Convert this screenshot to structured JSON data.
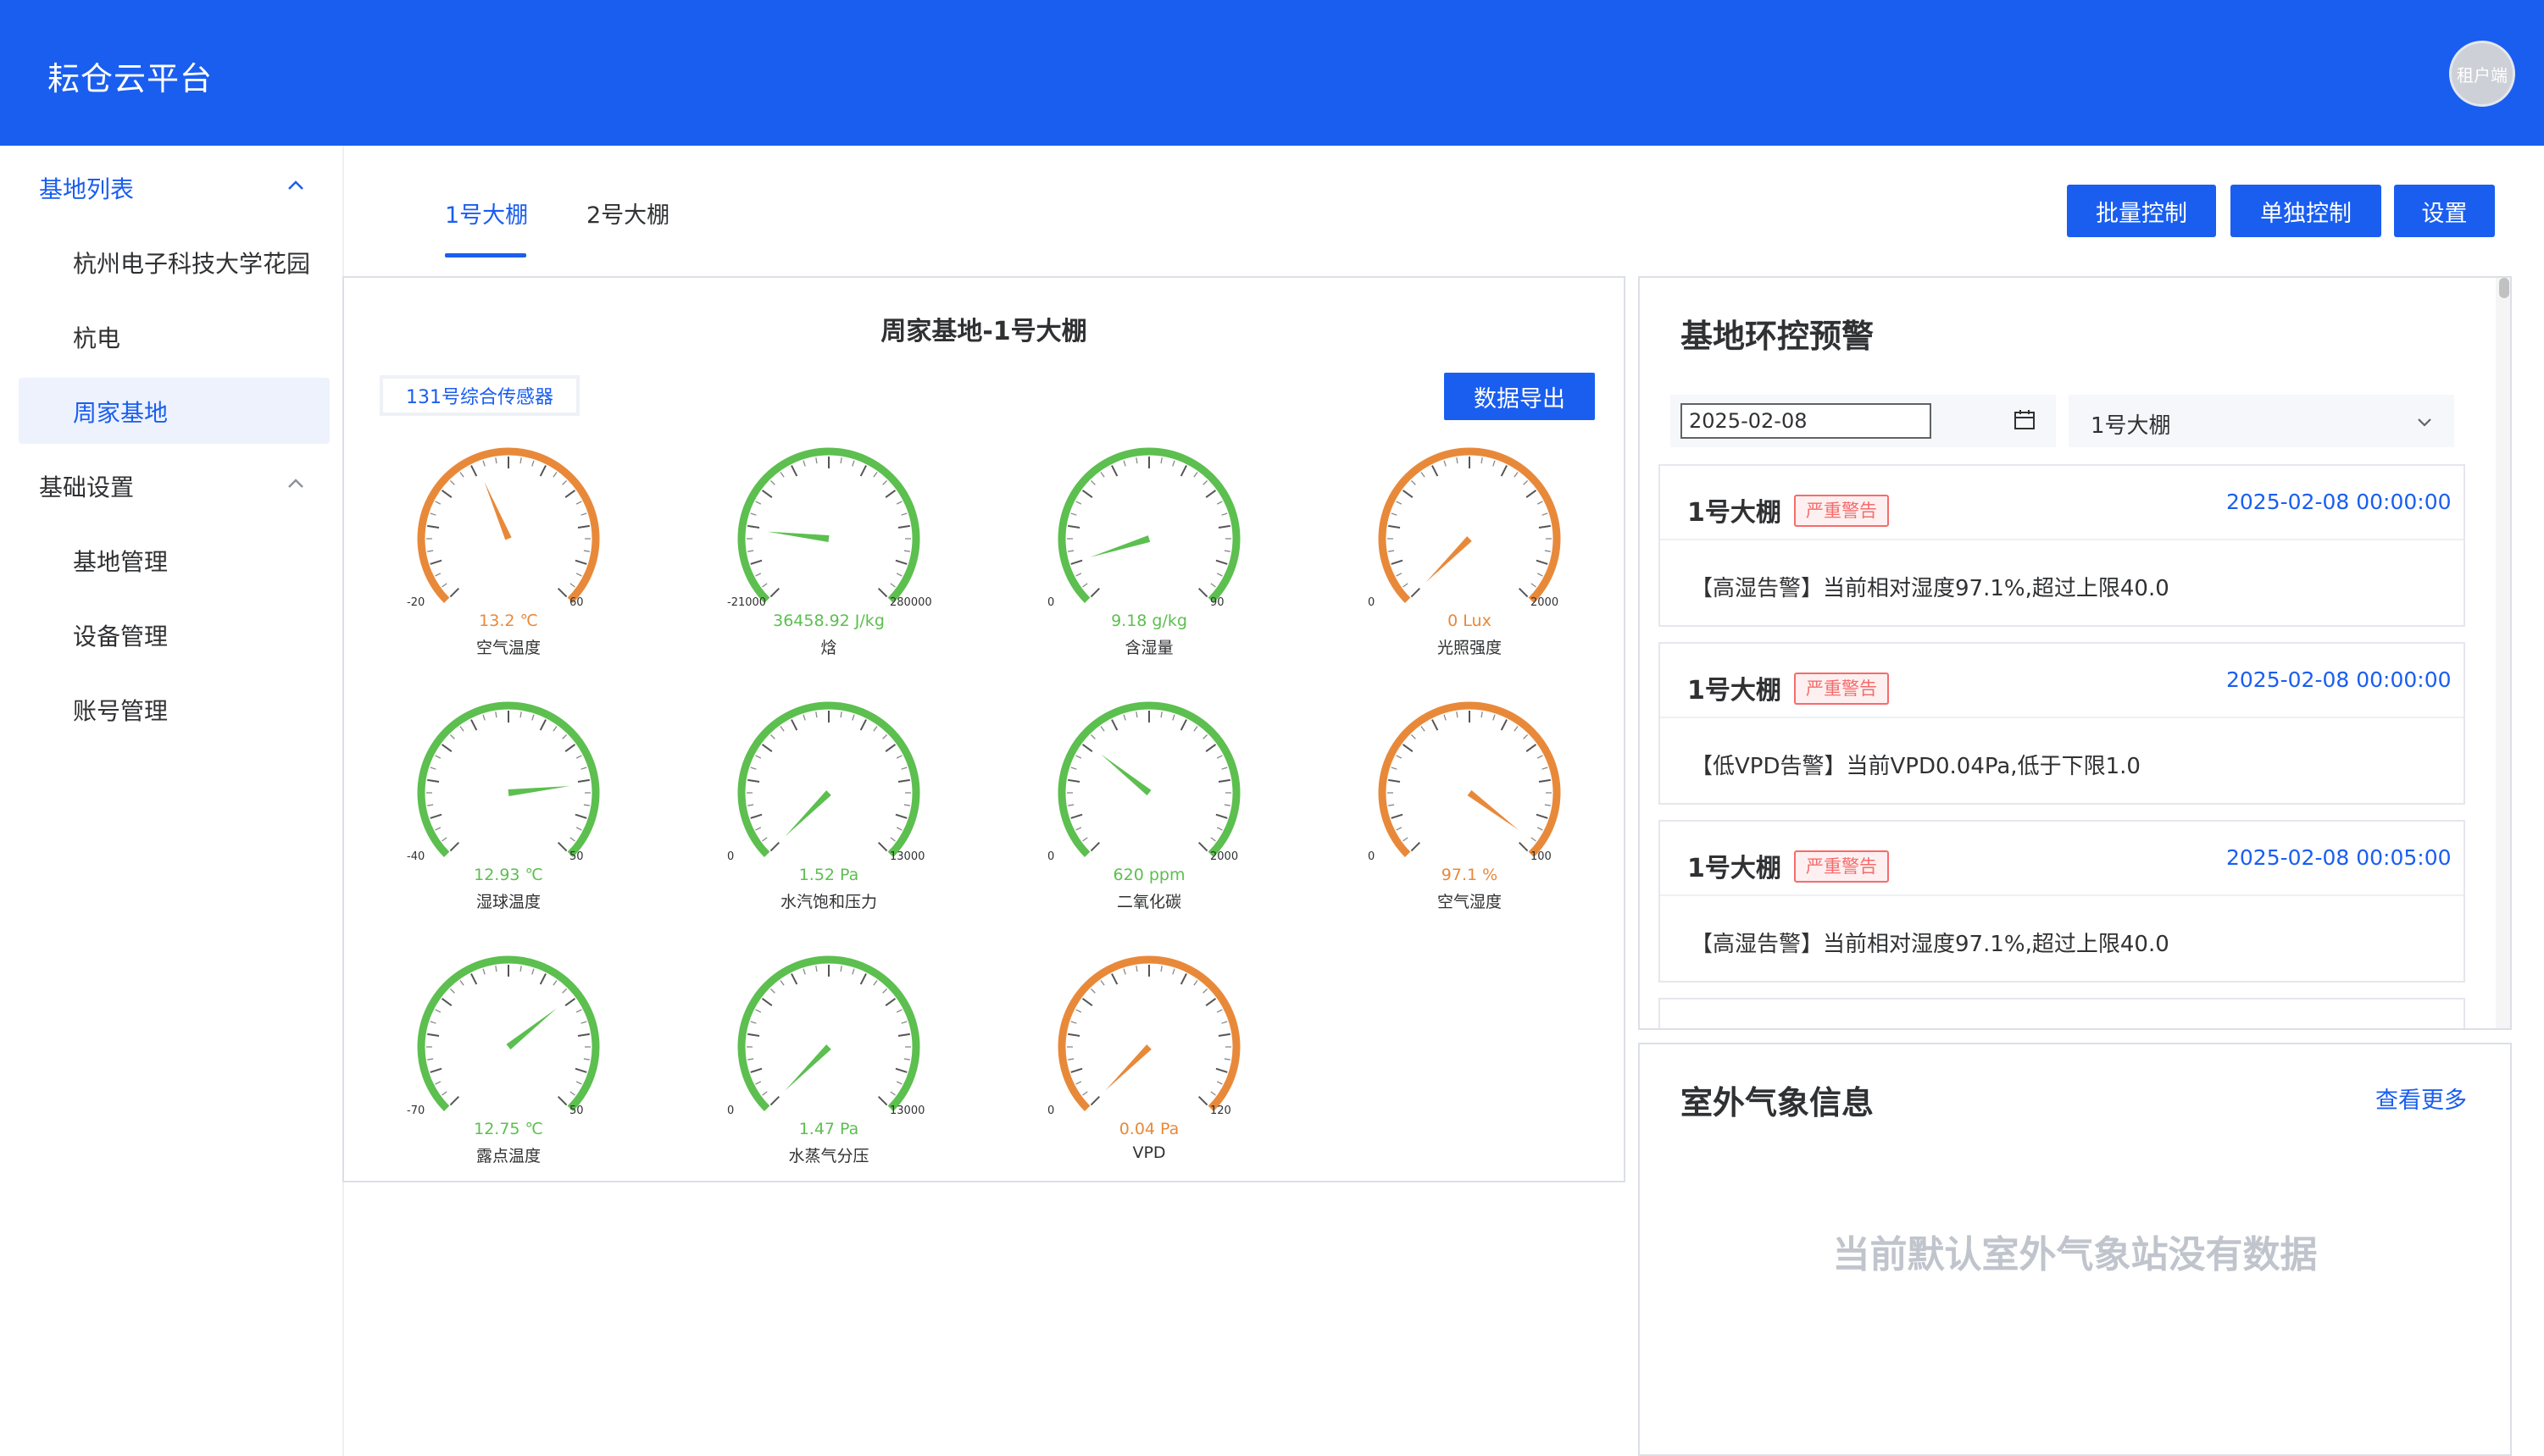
{
  "app": {
    "title": "耘仓云平台",
    "user_badge": "租户端"
  },
  "sidebar": {
    "group1": {
      "label": "基地列表",
      "items": [
        "杭州电子科技大学花园",
        "杭电",
        "周家基地"
      ]
    },
    "group2": {
      "label": "基础设置",
      "items": [
        "基地管理",
        "设备管理",
        "账号管理"
      ]
    }
  },
  "tabs": [
    "1号大棚",
    "2号大棚"
  ],
  "toolbar": {
    "batch": "批量控制",
    "single": "单独控制",
    "settings": "设置"
  },
  "gauge_panel": {
    "title": "周家基地-1号大棚",
    "sensor": "131号综合传感器",
    "export": "数据导出",
    "gauges": [
      {
        "name": "空气温度",
        "value": "13.2 ℃",
        "min": "-20",
        "max": "60",
        "fraction": 0.415,
        "status": "warn"
      },
      {
        "name": "焓",
        "value": "36458.92 J/kg",
        "min": "-21000",
        "max": "280000",
        "fraction": 0.191,
        "status": "ok"
      },
      {
        "name": "含湿量",
        "value": "9.18 g/kg",
        "min": "0",
        "max": "90",
        "fraction": 0.102,
        "status": "ok"
      },
      {
        "name": "光照强度",
        "value": "0 Lux",
        "min": "0",
        "max": "2000",
        "fraction": 0.0,
        "status": "warn"
      },
      {
        "name": "湿球温度",
        "value": "12.93 ℃",
        "min": "-40",
        "max": "50",
        "fraction": 0.81,
        "status": "ok"
      },
      {
        "name": "水汽饱和压力",
        "value": "1.52 Pa",
        "min": "0",
        "max": "13000",
        "fraction": 0.000117,
        "status": "ok"
      },
      {
        "name": "二氧化碳",
        "value": "620 ppm",
        "min": "0",
        "max": "2000",
        "fraction": 0.31,
        "status": "ok"
      },
      {
        "name": "空气湿度",
        "value": "97.1 %",
        "min": "0",
        "max": "100",
        "fraction": 0.971,
        "status": "warn"
      },
      {
        "name": "露点温度",
        "value": "12.75 ℃",
        "min": "-70",
        "max": "50",
        "fraction": 0.69,
        "status": "ok"
      },
      {
        "name": "水蒸气分压",
        "value": "1.47 Pa",
        "min": "0",
        "max": "13000",
        "fraction": 0.000113,
        "status": "ok"
      },
      {
        "name": "VPD",
        "value": "0.04 Pa",
        "min": "0",
        "max": "120",
        "fraction": 0.00033,
        "status": "warn"
      }
    ]
  },
  "alerts": {
    "title": "基地环控预警",
    "date": "2025-02-08",
    "greenhouse_select": "1号大棚",
    "items": [
      {
        "name": "1号大棚",
        "level": "严重警告",
        "time": "2025-02-08 00:00:00",
        "message": "【高湿告警】当前相对湿度97.1%,超过上限40.0"
      },
      {
        "name": "1号大棚",
        "level": "严重警告",
        "time": "2025-02-08 00:00:00",
        "message": "【低VPD告警】当前VPD0.04Pa,低于下限1.0"
      },
      {
        "name": "1号大棚",
        "level": "严重警告",
        "time": "2025-02-08 00:05:00",
        "message": "【高湿告警】当前相对湿度97.1%,超过上限40.0"
      }
    ]
  },
  "weather": {
    "title": "室外气象信息",
    "more": "查看更多",
    "empty": "当前默认室外气象站没有数据"
  },
  "colors": {
    "primary": "#1a5ef0",
    "ok": "#5cbf4f",
    "warn": "#e8893a",
    "danger": "#f56c6c"
  }
}
